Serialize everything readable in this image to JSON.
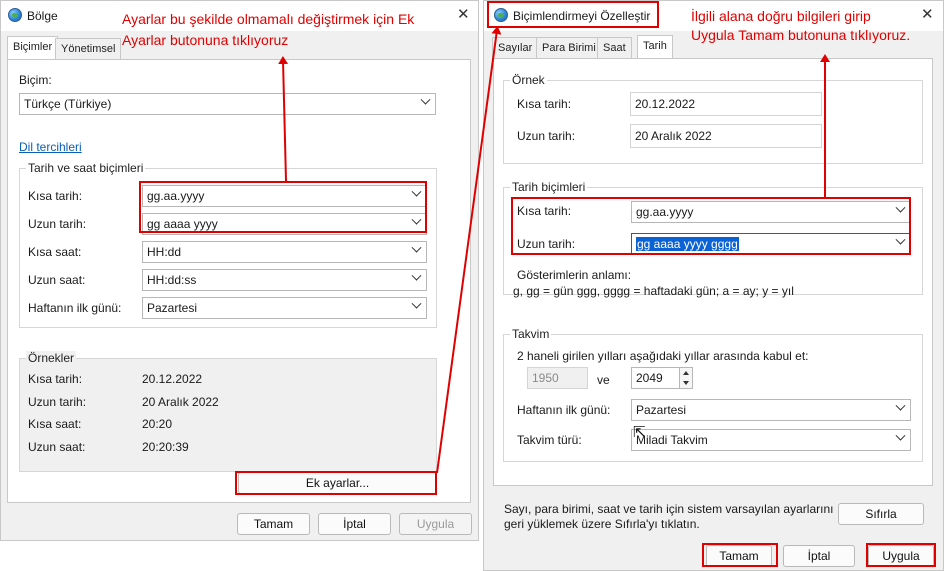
{
  "left_window": {
    "title": "Bölge",
    "tabs": [
      "Biçimler",
      "Yönetimsel"
    ],
    "format_label": "Biçim:",
    "format_value": "Türkçe (Türkiye)",
    "lang_link": "Dil tercihleri",
    "datetime_group": "Tarih ve saat biçimleri",
    "rows": [
      {
        "label": "Kısa tarih:",
        "value": "gg.aa.yyyy"
      },
      {
        "label": "Uzun tarih:",
        "value": "gg aaaa yyyy"
      },
      {
        "label": "Kısa saat:",
        "value": "HH:dd"
      },
      {
        "label": "Uzun saat:",
        "value": "HH:dd:ss"
      },
      {
        "label": "Haftanın ilk günü:",
        "value": "Pazartesi"
      }
    ],
    "examples_group": "Örnekler",
    "examples": [
      {
        "label": "Kısa tarih:",
        "value": "20.12.2022"
      },
      {
        "label": "Uzun tarih:",
        "value": "20 Aralık 2022"
      },
      {
        "label": "Kısa saat:",
        "value": "20:20"
      },
      {
        "label": "Uzun saat:",
        "value": "20:20:39"
      }
    ],
    "extra_button": "Ek ayarlar...",
    "ok": "Tamam",
    "cancel": "İptal",
    "apply": "Uygula"
  },
  "right_window": {
    "title": "Biçimlendirmeyi Özelleştir",
    "tabs": [
      "Sayılar",
      "Para Birimi",
      "Saat",
      "Tarih"
    ],
    "example_group": "Örnek",
    "example_short_label": "Kısa tarih:",
    "example_short_value": "20.12.2022",
    "example_long_label": "Uzun tarih:",
    "example_long_value": "20 Aralık 2022",
    "formats_group": "Tarih biçimleri",
    "short_label": "Kısa tarih:",
    "short_value": "gg.aa.yyyy",
    "long_label": "Uzun tarih:",
    "long_value": "gg aaaa yyyy gggg",
    "notation_title": "Gösterimlerin anlamı:",
    "notation_text": "g, gg = gün  ggg, gggg = haftadaki gün;  a = ay;  y = yıl",
    "calendar_group": "Takvim",
    "two_digit_text": "2 haneli girilen yılları aşağıdaki yıllar arasında kabul et:",
    "year_from": "1950",
    "year_and": "ve",
    "year_to": "2049",
    "first_day_label": "Haftanın ilk günü:",
    "first_day_value": "Pazartesi",
    "cal_type_label": "Takvim türü:",
    "cal_type_value": "Miladi Takvim",
    "reset_text_1": "Sayı, para birimi, saat ve tarih için sistem varsayılan ayarlarını",
    "reset_text_2": "geri yüklemek üzere Sıfırla'yı tıklatın.",
    "reset_button": "Sıfırla",
    "ok": "Tamam",
    "cancel": "İptal",
    "apply": "Uygula"
  },
  "annotations": {
    "left_line1": "Ayarlar bu şekilde olmamalı değiştirmek için Ek",
    "left_line2": "Ayarlar butonuna tıklıyoruz",
    "right_line1": "İlgili alana doğru bilgileri girip",
    "right_line2": "Uygula Tamam butonuna tıklıyoruz."
  },
  "colors": {
    "annotation_red": "#e00000",
    "selection_blue": "#0a62d4",
    "link_blue": "#0a5fb4"
  }
}
